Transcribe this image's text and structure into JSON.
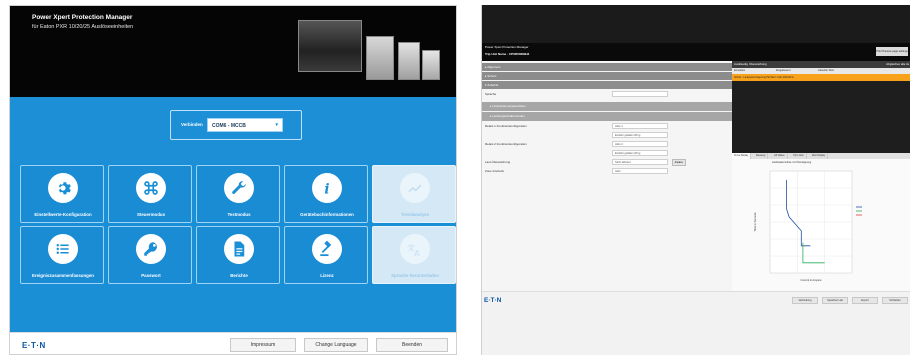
{
  "left_screen": {
    "header": {
      "title": "Power Xpert Protection Manager",
      "subtitle": "für Eaton PXR 10/20/25 Auslöseeinheiten"
    },
    "connection": {
      "label": "Verbinden",
      "selected": "COM6 - MCCB"
    },
    "tiles_row1": [
      {
        "label": "Einstellwerte-Konfiguration",
        "icon": "gear-icon",
        "enabled": true
      },
      {
        "label": "Steuermodus",
        "icon": "command-icon",
        "enabled": true
      },
      {
        "label": "Testmodus",
        "icon": "wrench-icon",
        "enabled": true
      },
      {
        "label": "Gerätebuchinformationen",
        "icon": "info-icon",
        "enabled": true
      },
      {
        "label": "Trendanalyse",
        "icon": "trend-icon",
        "enabled": false
      }
    ],
    "tiles_row2": [
      {
        "label": "Ereigniszusammenfassungen",
        "icon": "list-icon",
        "enabled": true
      },
      {
        "label": "Passwort",
        "icon": "key-icon",
        "enabled": true
      },
      {
        "label": "Berichte",
        "icon": "document-icon",
        "enabled": true
      },
      {
        "label": "Lizenz",
        "icon": "gavel-icon",
        "enabled": true
      },
      {
        "label": "Sprache herunterladen",
        "icon": "translate-icon",
        "enabled": false
      }
    ],
    "footer": {
      "logo": "E·T·N",
      "buttons": [
        "Impressum",
        "Change Language",
        "Beenden"
      ]
    },
    "colors": {
      "accent": "#1a8fd6",
      "header": "#050505"
    }
  },
  "right_screen": {
    "titlebar": {
      "title": "Power Xpert Protection Manager",
      "subtitle": "Trip Unit Name - CPXR00289H4",
      "top_button": "Print Preview page settings"
    },
    "form": {
      "sections": [
        "Allgemein",
        "Schutz",
        "Zubehör"
      ],
      "subsections": [
        "Unterspannungsauslöser",
        "Leistungsschaltermodus"
      ],
      "rows": [
        {
          "label": "Sprache",
          "value": ""
        },
        {
          "label": "Relais 1 Funktionskonfiguration",
          "value": "Aktiv 1"
        },
        {
          "label": "",
          "value": "Einfach gefallen Wrng"
        },
        {
          "label": "Relais 2 Funktionskonfiguration",
          "value": "Aktiv 2"
        },
        {
          "label": "",
          "value": "Einfach gefallen Wrng"
        },
        {
          "label": "Last-Überwachung",
          "value": "Nicht aktiviert"
        },
        {
          "label": "Zone Interlock",
          "value": "Aktiv"
        }
      ],
      "small_button": "Anpass."
    },
    "log": {
      "header": "Auslösedig. Überwachung",
      "header_right": "Abgleichen alle 4s",
      "columns": [
        "Einstellen",
        "Eingabewert",
        "Aktueller Wert"
      ],
      "highlight_row": "Schutz - Langzeitverzögerung   Pkt-Wert 1    Abs 400/110 A"
    },
    "chart_tabs": [
      "Curve Display",
      "Messung",
      "Lift Values",
      "Trip Limits",
      "Wert Display"
    ],
    "chart_title": "Auslösekennlinie mit Überlappung",
    "chart_data": {
      "type": "line",
      "title": "",
      "xlabel": "Current in Ampere",
      "ylabel": "Time in Seconds",
      "x_scale": "log",
      "y_scale": "log",
      "xlim": [
        100,
        100000
      ],
      "ylim": [
        0.01,
        10000
      ],
      "series": [
        {
          "name": "",
          "color": "#2850a0",
          "x": [
            400,
            400,
            500,
            1400,
            1400,
            3000
          ],
          "y": [
            3000,
            60,
            20,
            3,
            0.4,
            0.4
          ]
        },
        {
          "name": "",
          "color": "#27b05a",
          "x": [
            1600,
            1600,
            10000
          ],
          "y": [
            0.6,
            0.04,
            0.04
          ]
        },
        {
          "name": "",
          "color": "#e23c3c",
          "x": [],
          "y": []
        }
      ]
    },
    "bottom_bar": {
      "logo": "E·T·N",
      "buttons": [
        "Verbindung",
        "Speichern als",
        "Export",
        "Schließen"
      ]
    }
  }
}
